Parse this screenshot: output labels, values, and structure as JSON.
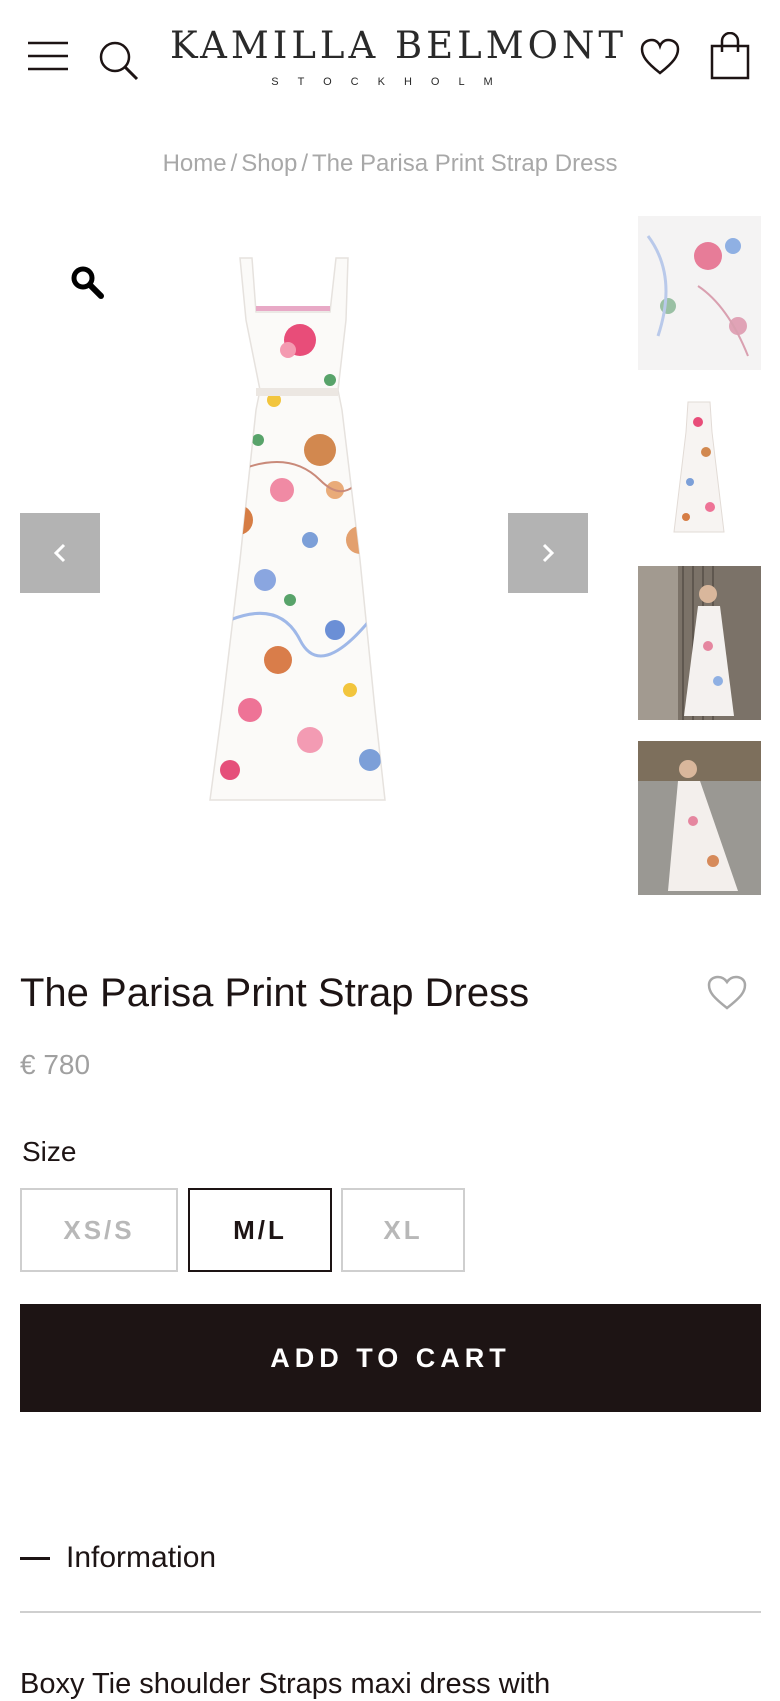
{
  "header": {
    "brand_name": "KAMILLA BELMONT",
    "brand_city": "STOCKHOLM",
    "icons": [
      "menu-icon",
      "search-icon",
      "heart-icon",
      "bag-icon"
    ]
  },
  "breadcrumb": {
    "items": [
      "Home",
      "Shop",
      "The Parisa Print Strap Dress"
    ],
    "separator": "/"
  },
  "gallery": {
    "icons": [
      "zoom-icon",
      "prev-arrow-icon",
      "next-arrow-icon"
    ],
    "thumbnails": [
      "thumb-print-detail",
      "thumb-dress-front",
      "thumb-model-standing",
      "thumb-model-seated"
    ]
  },
  "product": {
    "title": "The Parisa Print Strap Dress",
    "price": "€ 780",
    "size_label": "Size",
    "sizes": [
      "XS/S",
      "M/L",
      "XL"
    ],
    "selected_size": "M/L",
    "add_to_cart": "ADD TO CART"
  },
  "accordion": {
    "info_label": "Information",
    "description_start": "Boxy Tie shoulder Straps maxi dress with"
  },
  "colors": {
    "dark": "#1d1414",
    "muted": "#a8a8a8",
    "nav_button": "#b3b3b3"
  }
}
